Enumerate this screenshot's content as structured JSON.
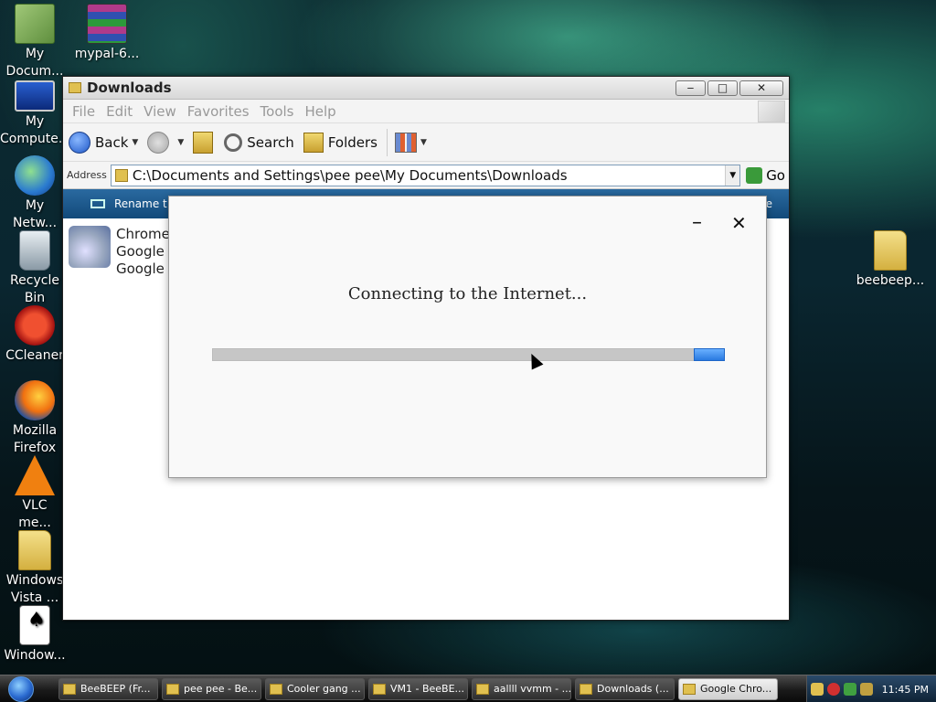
{
  "desktop": {
    "icons": [
      {
        "label": "My\nDocum..."
      },
      {
        "label": "mypal-6..."
      },
      {
        "label": "My\nCompute..."
      },
      {
        "label": "My\nNetw..."
      },
      {
        "label": "Recycle\nBin"
      },
      {
        "label": "CCleaner"
      },
      {
        "label": "Mozilla\nFirefox"
      },
      {
        "label": "VLC\nme..."
      },
      {
        "label": "Windows\nVista ..."
      },
      {
        "label": "Window..."
      },
      {
        "label": "beebeep..."
      }
    ]
  },
  "explorer": {
    "title": "Downloads",
    "controls": {
      "minimize": "‒",
      "maximize": "□",
      "close": "✕"
    },
    "menu": [
      "File",
      "Edit",
      "View",
      "Favorites",
      "Tools",
      "Help"
    ],
    "toolbar": {
      "back": "Back",
      "search": "Search",
      "folders": "Folders"
    },
    "address": {
      "label": "Address",
      "value": "C:\\Documents and Settings\\pee pee\\My Documents\\Downloads",
      "go": "Go"
    },
    "task_strip": {
      "left": "Rename t",
      "right": "e"
    },
    "file": {
      "line1": "Chrome",
      "line2": "Google U",
      "line3": "Google I"
    }
  },
  "dialog": {
    "message": "Connecting to the Internet...",
    "minimize": "–",
    "close": "✕",
    "progress": {
      "state": "indeterminate"
    }
  },
  "taskbar": {
    "buttons": [
      {
        "label": "BeeBEEP (Fr...",
        "active": false
      },
      {
        "label": "pee pee - Be...",
        "active": false
      },
      {
        "label": "Cooler gang ...",
        "active": false
      },
      {
        "label": "VM1 - BeeBE...",
        "active": false
      },
      {
        "label": "aallll vvmm - ...",
        "active": false
      },
      {
        "label": "Downloads (...",
        "active": false
      },
      {
        "label": "Google Chro...",
        "active": true
      }
    ],
    "clock": "11:45 PM"
  }
}
